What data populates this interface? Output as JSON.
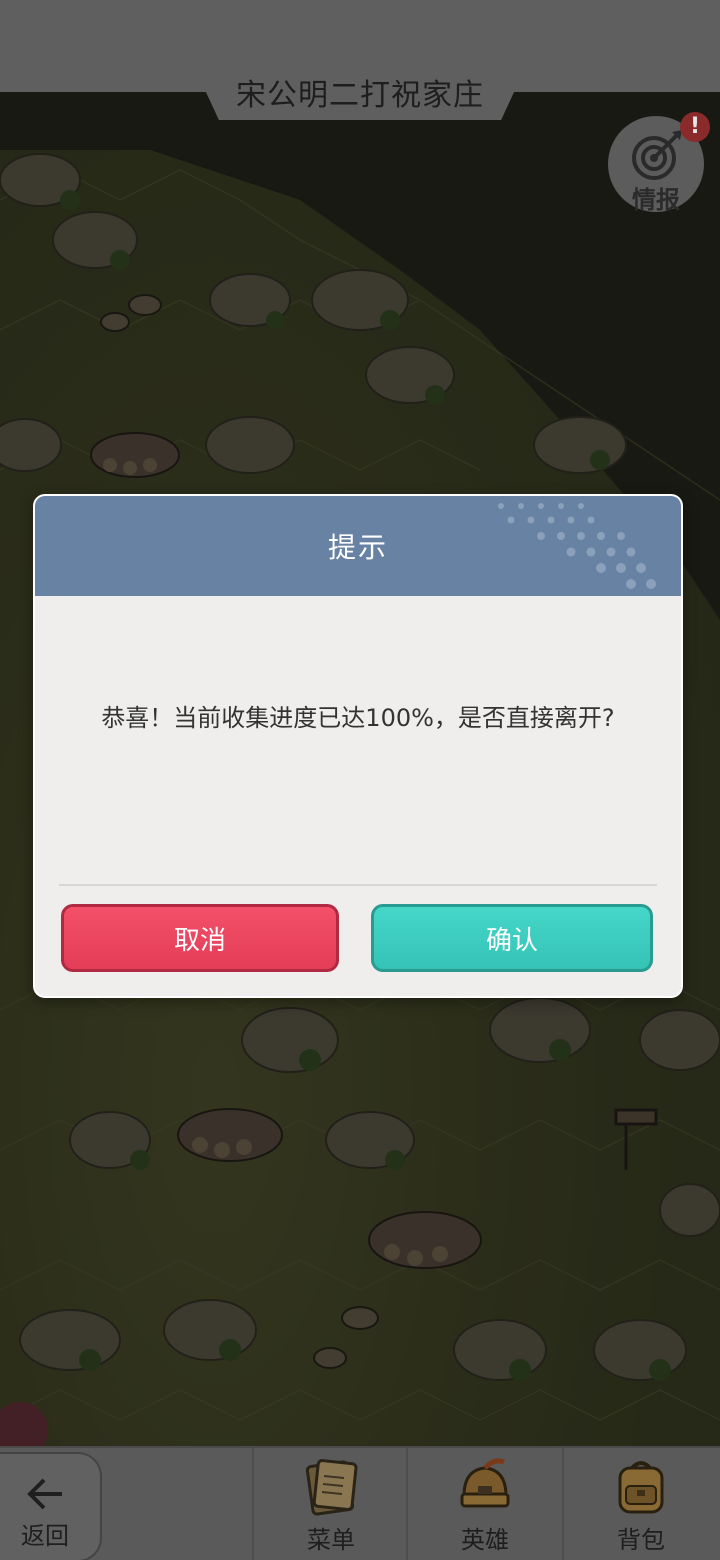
{
  "stage": {
    "title": "宋公明二打祝家庄"
  },
  "intel": {
    "label": "情报",
    "badge": "!",
    "icon": "target-icon"
  },
  "dialog": {
    "title": "提示",
    "message": "恭喜！当前收集进度已达100%，是否直接离开?",
    "cancel_label": "取消",
    "confirm_label": "确认",
    "colors": {
      "header": "#6882a3",
      "cancel": "#f04763",
      "confirm": "#3fcfc1"
    }
  },
  "bottom_nav": {
    "back_label": "返回",
    "items": [
      {
        "label": "菜单",
        "icon": "scroll-icon"
      },
      {
        "label": "英雄",
        "icon": "hero-helmet-icon"
      },
      {
        "label": "背包",
        "icon": "backpack-icon"
      }
    ]
  }
}
